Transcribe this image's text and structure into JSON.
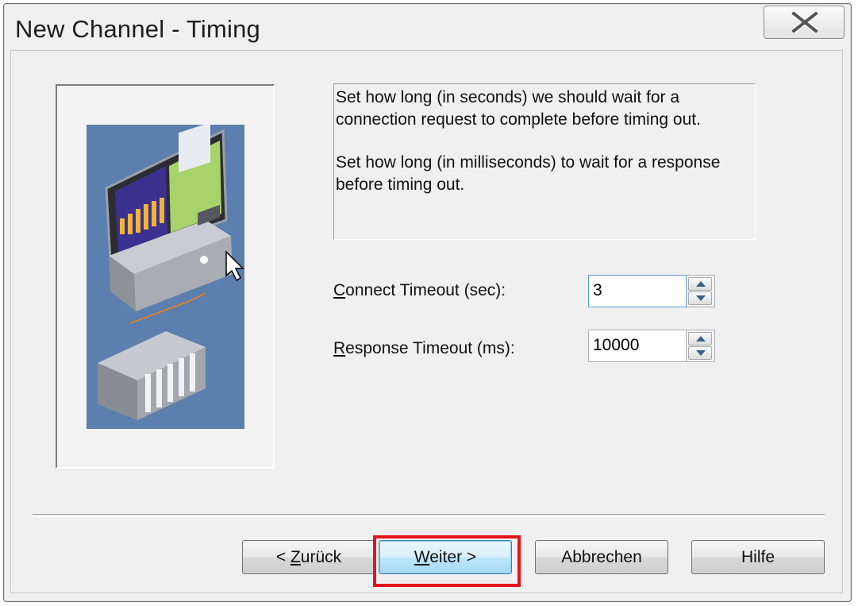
{
  "window": {
    "title": "New Channel - Timing"
  },
  "description": {
    "line1": "Set how long (in seconds) we should wait for a connection request to complete before timing out.",
    "line2": "Set how long (in milliseconds) to wait for a response before timing out."
  },
  "fields": {
    "connect_timeout": {
      "label_mnemonic": "C",
      "label_rest": "onnect Timeout (sec):",
      "value": "3"
    },
    "response_timeout": {
      "label_mnemonic": "R",
      "label_rest": "esponse Timeout (ms):",
      "value": "10000"
    }
  },
  "buttons": {
    "back": {
      "prefix": "< ",
      "mnemonic": "Z",
      "rest": "urück"
    },
    "next": {
      "mnemonic": "W",
      "rest": "eiter >"
    },
    "cancel": "Abbrechen",
    "help": "Hilfe"
  },
  "icons": {
    "close": "close-icon",
    "spin_up": "arrow-up-icon",
    "spin_down": "arrow-down-icon"
  },
  "colors": {
    "illustration_bg": "#5b7fae",
    "highlight": "#e3131b",
    "default_button": "#a7d9f5"
  }
}
